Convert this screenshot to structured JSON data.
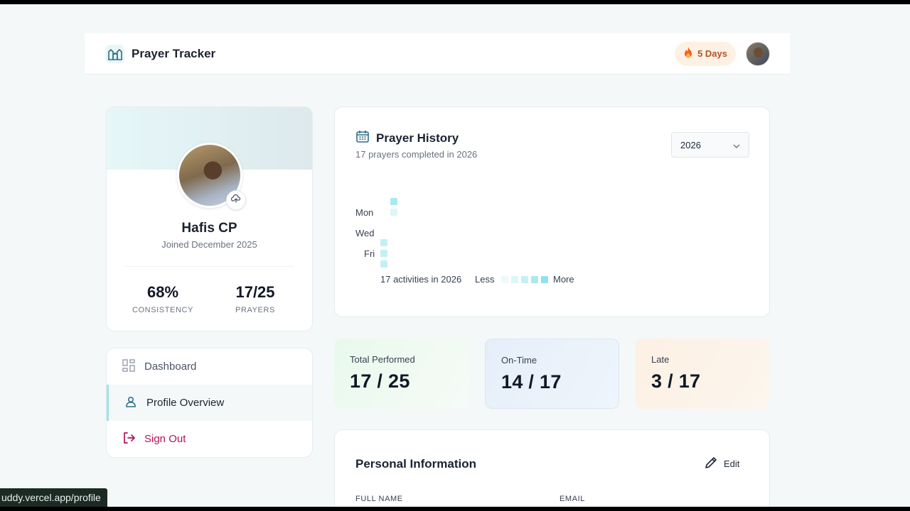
{
  "header": {
    "brand_title": "Prayer Tracker",
    "streak_label": "5 Days"
  },
  "profile": {
    "name": "Hafis CP",
    "joined": "Joined December 2025",
    "consistency_value": "68%",
    "consistency_label": "CONSISTENCY",
    "prayers_value": "17/25",
    "prayers_label": "PRAYERS"
  },
  "nav": {
    "items": [
      {
        "label": "Dashboard",
        "icon": "dashboard-icon"
      },
      {
        "label": "Profile Overview",
        "icon": "user-icon"
      },
      {
        "label": "Sign Out",
        "icon": "sign-out-icon"
      }
    ]
  },
  "history": {
    "title": "Prayer History",
    "subtitle": "17 prayers completed in 2026",
    "year": "2026",
    "day_labels": [
      "Mon",
      "Wed",
      "Fri"
    ],
    "activity_text": "17 activities in 2026",
    "legend_less": "Less",
    "legend_more": "More"
  },
  "metrics": [
    {
      "label": "Total Performed",
      "value": "17 / 25",
      "bg": "#ecf9ee"
    },
    {
      "label": "On-Time",
      "value": "14 / 17",
      "bg": "#e8f1fb"
    },
    {
      "label": "Late",
      "value": "3 / 17",
      "bg": "#fdf3e6"
    }
  ],
  "personal_info": {
    "title": "Personal Information",
    "edit_label": "Edit",
    "full_name_label": "FULL NAME",
    "email_label": "EMAIL"
  },
  "status_url": "uddy.vercel.app/profile",
  "colors": {
    "accent": "#8fe2ee",
    "sign_out": "#b3135a",
    "streak": "#b3542a"
  }
}
